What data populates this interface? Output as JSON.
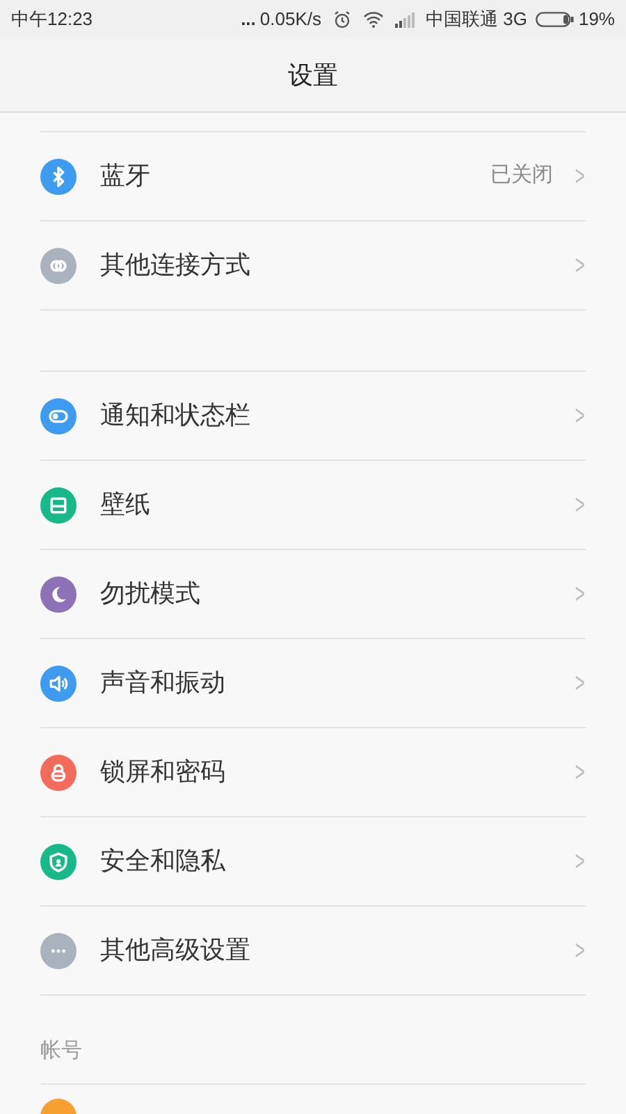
{
  "status_bar": {
    "time": "中午12:23",
    "dots": "...",
    "speed": "0.05K/s",
    "carrier": "中国联通 3G",
    "battery": "19%"
  },
  "title": "设置",
  "sections": [
    {
      "items": [
        {
          "kind": "bluetooth",
          "label": "蓝牙",
          "value": "已关闭",
          "chevron": ">"
        },
        {
          "kind": "link",
          "label": "其他连接方式",
          "chevron": ">"
        }
      ]
    },
    {
      "items": [
        {
          "kind": "toggle",
          "label": "通知和状态栏",
          "chevron": ">"
        },
        {
          "kind": "wallpaper",
          "label": "壁纸",
          "chevron": ">"
        },
        {
          "kind": "moon",
          "label": "勿扰模式",
          "chevron": ">"
        },
        {
          "kind": "sound",
          "label": "声音和振动",
          "chevron": ">"
        },
        {
          "kind": "lock",
          "label": "锁屏和密码",
          "chevron": ">"
        },
        {
          "kind": "shield",
          "label": "安全和隐私",
          "chevron": ">"
        },
        {
          "kind": "more",
          "label": "其他高级设置",
          "chevron": ">"
        }
      ]
    },
    {
      "header": "帐号"
    }
  ]
}
